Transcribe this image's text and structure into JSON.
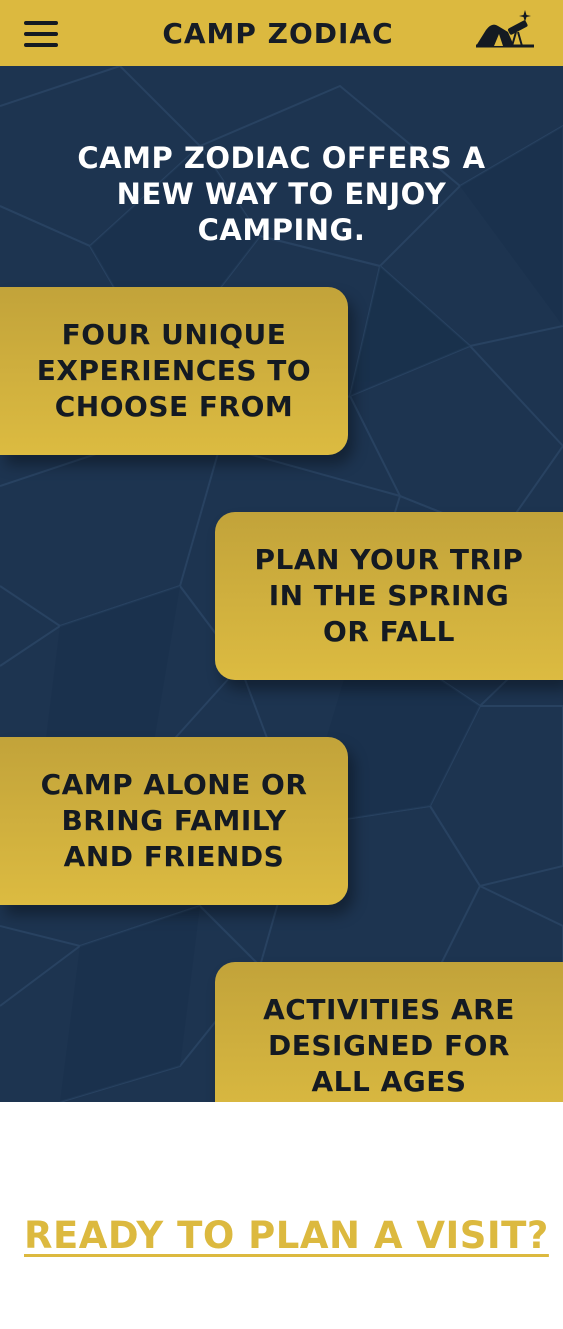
{
  "header": {
    "logo_text": "CAMP ZODIAC",
    "menu_icon": "hamburger-menu-icon",
    "tent_icon": "tent-telescope-icon"
  },
  "hero": {
    "title": "CAMP ZODIAC OFFERS A NEW WAY TO ENJOY CAMPING.",
    "cards": [
      {
        "text": "FOUR UNIQUE EXPERIENCES TO CHOOSE FROM"
      },
      {
        "text": "PLAN YOUR TRIP IN THE SPRING OR FALL"
      },
      {
        "text": "CAMP ALONE OR BRING FAMILY AND FRIENDS"
      },
      {
        "text": "ACTIVITIES ARE DESIGNED FOR ALL AGES"
      }
    ]
  },
  "cta": {
    "label": "READY TO PLAN A VISIT?",
    "icon": "arrow-right-icon"
  },
  "colors": {
    "brand_yellow": "#dcb93f",
    "navy": "#1d3450",
    "dark_text": "#141a22"
  }
}
